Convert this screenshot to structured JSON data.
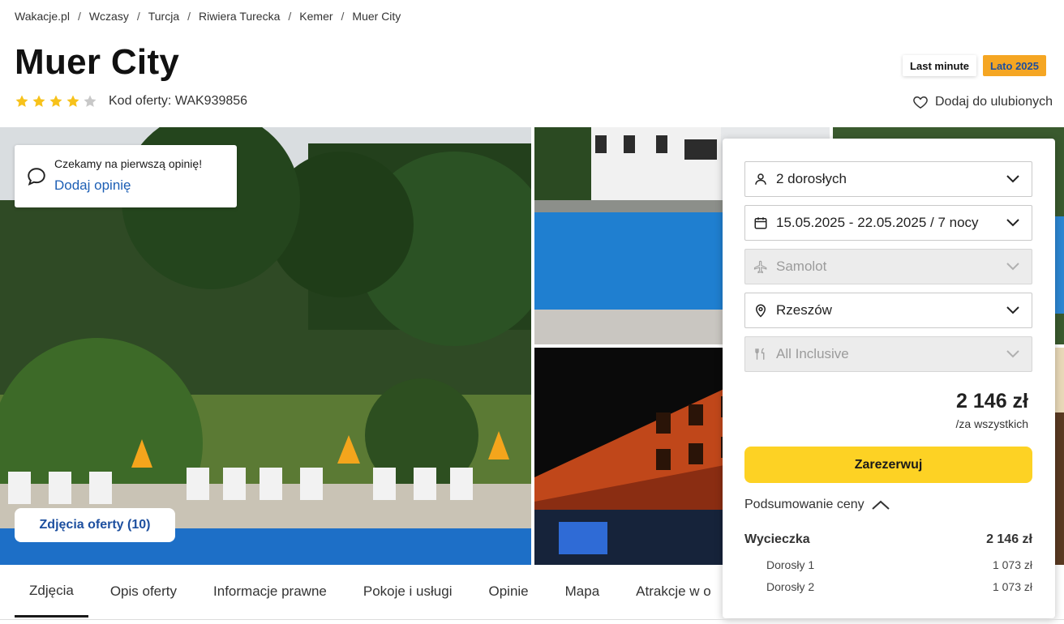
{
  "breadcrumb": [
    "Wakacje.pl",
    "Wczasy",
    "Turcja",
    "Riwiera Turecka",
    "Kemer",
    "Muer City"
  ],
  "hotel": {
    "name": "Muer City",
    "stars_filled": 4,
    "stars_total": 5,
    "offer_code": "Kod oferty: WAK939856"
  },
  "badges": {
    "last_minute": "Last minute",
    "season": "Lato 2025"
  },
  "favorite_label": "Dodaj do ulubionych",
  "review_card": {
    "text": "Czekamy na pierwszą opinię!",
    "link": "Dodaj opinię"
  },
  "photos_button": "Zdjęcia oferty (10)",
  "booking": {
    "travelers": "2 dorosłych",
    "dates": "15.05.2025 - 22.05.2025 / 7 nocy",
    "transport": "Samolot",
    "departure": "Rzeszów",
    "board": "All Inclusive",
    "price": "2 146 zł",
    "price_note": "/za wszystkich",
    "reserve_label": "Zarezerwuj",
    "summary_label": "Podsumowanie ceny",
    "summary": {
      "trip_label": "Wycieczka",
      "trip_price": "2 146 zł",
      "adults": [
        {
          "label": "Dorosły 1",
          "price": "1 073 zł"
        },
        {
          "label": "Dorosły 2",
          "price": "1 073 zł"
        }
      ]
    }
  },
  "tabs": [
    "Zdjęcia",
    "Opis oferty",
    "Informacje prawne",
    "Pokoje i usługi",
    "Opinie",
    "Mapa",
    "Atrakcje w o"
  ],
  "colors": {
    "accent_yellow": "#fdd224",
    "link_blue": "#1d5fb5",
    "season_badge": "#f5a623",
    "star": "#f7c21b"
  }
}
